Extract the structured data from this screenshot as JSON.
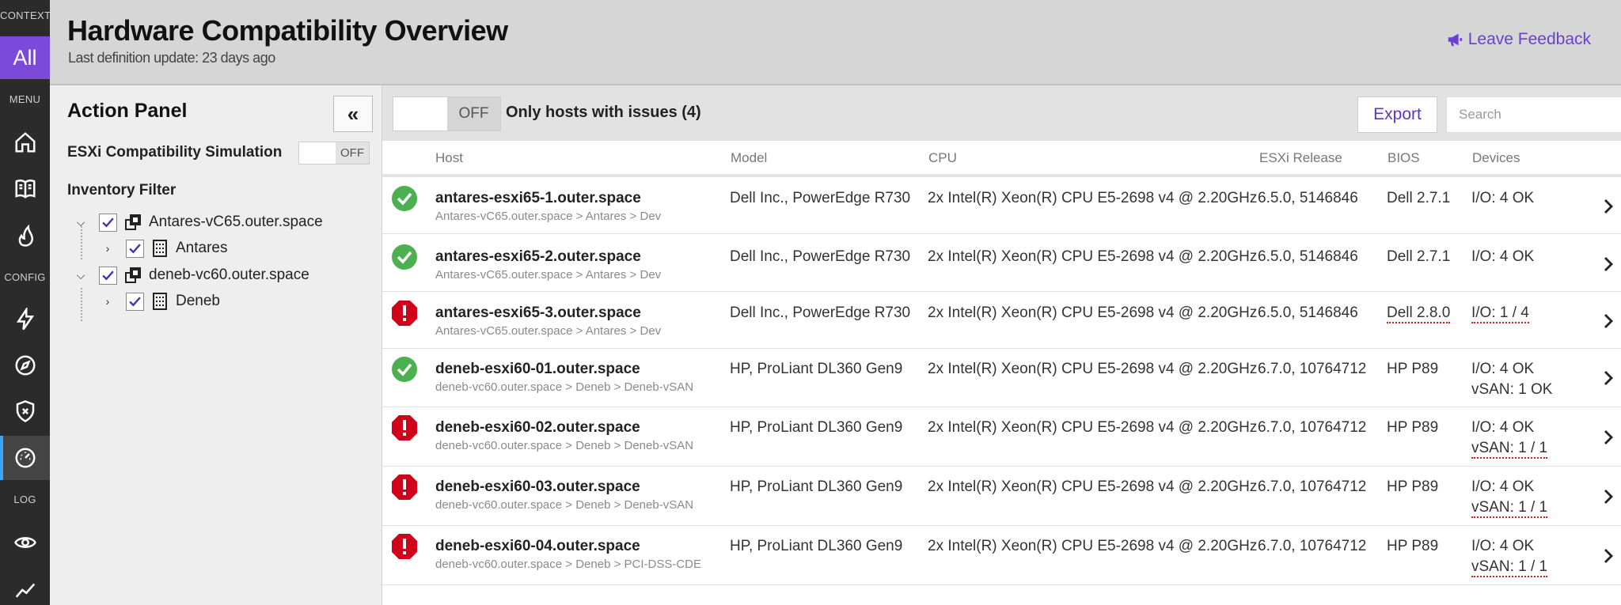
{
  "nav": {
    "context_label": "CONTEXT",
    "all_label": "All",
    "menu_label": "MENU",
    "config_label": "CONFIG",
    "log_label": "LOG"
  },
  "header": {
    "title": "Hardware Compatibility Overview",
    "subtitle": "Last definition update: 23 days ago",
    "feedback_label": "Leave Feedback"
  },
  "action_panel": {
    "title": "Action Panel",
    "collapse_glyph": "«",
    "simulation_label": "ESXi Compatibility Simulation",
    "simulation_state": "OFF",
    "inventory_label": "Inventory Filter",
    "tree": [
      {
        "label": "Antares-vC65.outer.space",
        "type": "vcenter",
        "expanded": true,
        "checked": true
      },
      {
        "label": "Antares",
        "type": "datacenter",
        "expanded": false,
        "checked": true
      },
      {
        "label": "deneb-vc60.outer.space",
        "type": "vcenter",
        "expanded": true,
        "checked": true
      },
      {
        "label": "Deneb",
        "type": "datacenter",
        "expanded": false,
        "checked": true
      }
    ]
  },
  "toolbar": {
    "issues_toggle_state": "OFF",
    "issues_label": "Only hosts with issues (4)",
    "export_label": "Export",
    "search_placeholder": "Search",
    "search_value": ""
  },
  "table": {
    "columns": [
      "Host",
      "Model",
      "CPU",
      "ESXi Release",
      "BIOS",
      "Devices"
    ],
    "rows": [
      {
        "status": "ok",
        "host": "antares-esxi65-1.outer.space",
        "path": "Antares-vC65.outer.space > Antares > Dev",
        "model": "Dell Inc.,  PowerEdge R730",
        "cpu": "2x Intel(R) Xeon(R) CPU E5-2698 v4 @ 2.20GHz",
        "esxi": "6.5.0, 5146846",
        "bios": "Dell 2.7.1",
        "bios_issue": false,
        "devices": [
          {
            "text": "I/O: 4 OK",
            "issue": false
          }
        ]
      },
      {
        "status": "ok",
        "host": "antares-esxi65-2.outer.space",
        "path": "Antares-vC65.outer.space > Antares > Dev",
        "model": "Dell Inc.,  PowerEdge R730",
        "cpu": "2x Intel(R) Xeon(R) CPU E5-2698 v4 @ 2.20GHz",
        "esxi": "6.5.0, 5146846",
        "bios": "Dell 2.7.1",
        "bios_issue": false,
        "devices": [
          {
            "text": "I/O: 4 OK",
            "issue": false
          }
        ]
      },
      {
        "status": "error",
        "host": "antares-esxi65-3.outer.space",
        "path": "Antares-vC65.outer.space > Antares > Dev",
        "model": "Dell Inc.,  PowerEdge R730",
        "cpu": "2x Intel(R) Xeon(R) CPU E5-2698 v4 @ 2.20GHz",
        "esxi": "6.5.0, 5146846",
        "bios": "Dell 2.8.0",
        "bios_issue": true,
        "devices": [
          {
            "text": "I/O: 1 / 4",
            "issue": true
          }
        ]
      },
      {
        "status": "ok",
        "host": "deneb-esxi60-01.outer.space",
        "path": "deneb-vc60.outer.space > Deneb > Deneb-vSAN",
        "model": "HP,  ProLiant DL360 Gen9",
        "cpu": "2x Intel(R) Xeon(R) CPU E5-2698 v4 @ 2.20GHz",
        "esxi": "6.7.0, 10764712",
        "bios": "HP P89",
        "bios_issue": false,
        "devices": [
          {
            "text": "I/O: 4 OK",
            "issue": false
          },
          {
            "text": "vSAN: 1 OK",
            "issue": false
          }
        ]
      },
      {
        "status": "error",
        "host": "deneb-esxi60-02.outer.space",
        "path": "deneb-vc60.outer.space > Deneb > Deneb-vSAN",
        "model": "HP,  ProLiant DL360 Gen9",
        "cpu": "2x Intel(R) Xeon(R) CPU E5-2698 v4 @ 2.20GHz",
        "esxi": "6.7.0, 10764712",
        "bios": "HP P89",
        "bios_issue": false,
        "devices": [
          {
            "text": "I/O: 4 OK",
            "issue": false
          },
          {
            "text": "vSAN: 1 / 1",
            "issue": true
          }
        ]
      },
      {
        "status": "error",
        "host": "deneb-esxi60-03.outer.space",
        "path": "deneb-vc60.outer.space > Deneb > Deneb-vSAN",
        "model": "HP,  ProLiant DL360 Gen9",
        "cpu": "2x Intel(R) Xeon(R) CPU E5-2698 v4 @ 2.20GHz",
        "esxi": "6.7.0, 10764712",
        "bios": "HP P89",
        "bios_issue": false,
        "devices": [
          {
            "text": "I/O: 4 OK",
            "issue": false
          },
          {
            "text": "vSAN: 1 / 1",
            "issue": true
          }
        ]
      },
      {
        "status": "error",
        "host": "deneb-esxi60-04.outer.space",
        "path": "deneb-vc60.outer.space > Deneb > PCI-DSS-CDE",
        "model": "HP,  ProLiant DL360 Gen9",
        "cpu": "2x Intel(R) Xeon(R) CPU E5-2698 v4 @ 2.20GHz",
        "esxi": "6.7.0, 10764712",
        "bios": "HP P89",
        "bios_issue": false,
        "devices": [
          {
            "text": "I/O: 4 OK",
            "issue": false
          },
          {
            "text": "vSAN: 1 / 1",
            "issue": true
          }
        ]
      }
    ]
  },
  "colors": {
    "accent": "#7b4ad8",
    "ok": "#4caf50",
    "error": "#d0021b",
    "link": "#6a3fd3"
  }
}
